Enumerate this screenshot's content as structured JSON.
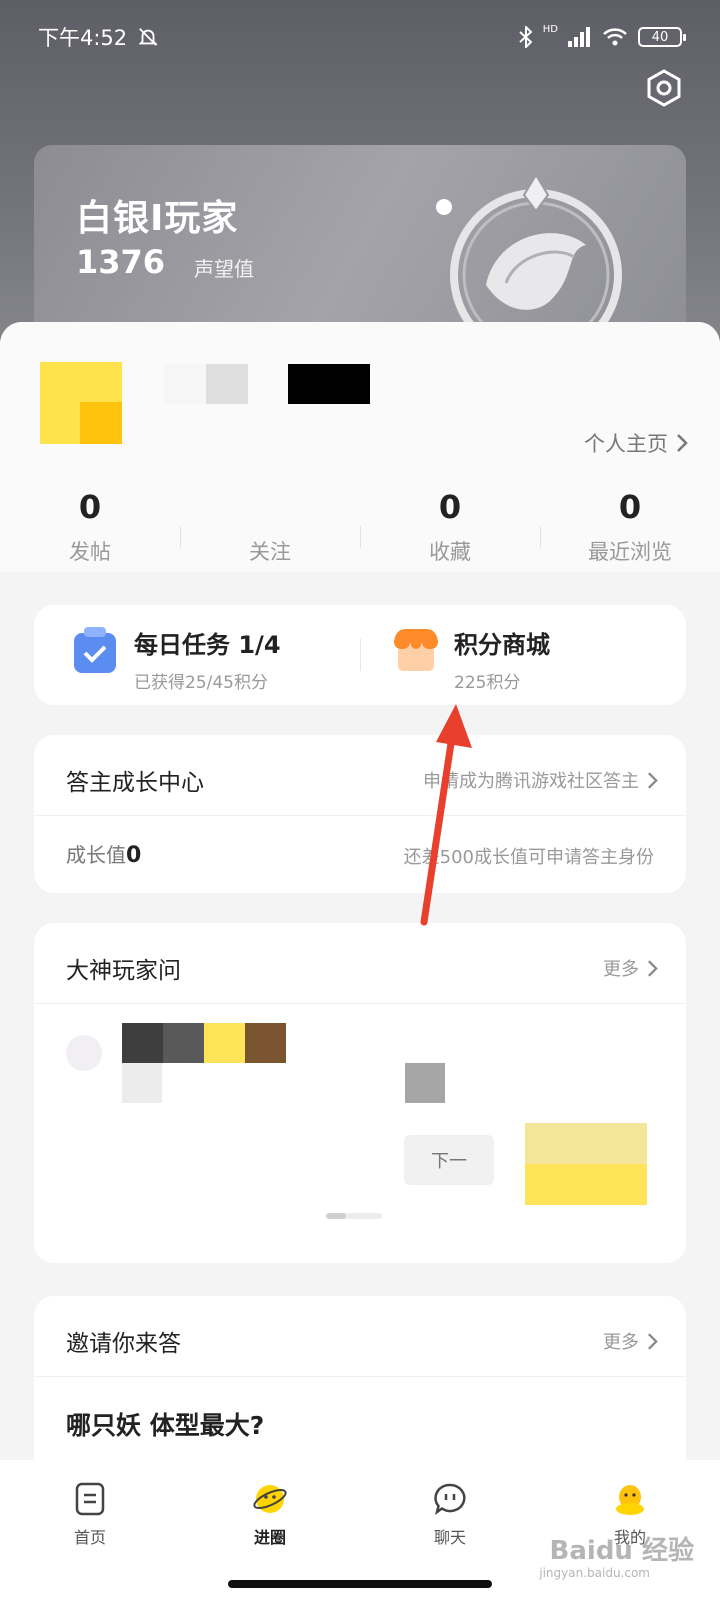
{
  "status_bar": {
    "time": "下午4:52",
    "network": "HD",
    "battery": "40"
  },
  "rank": {
    "title": "白银I玩家",
    "score": "1376",
    "score_label": "声望值"
  },
  "profile": {
    "homepage_link": "个人主页"
  },
  "stats": [
    {
      "num": "0",
      "label": "发帖"
    },
    {
      "num": "",
      "label": "关注"
    },
    {
      "num": "0",
      "label": "收藏"
    },
    {
      "num": "0",
      "label": "最近浏览"
    }
  ],
  "daily_task": {
    "title": "每日任务 1/4",
    "sub": "已获得25/45积分"
  },
  "points_mall": {
    "title": "积分商城",
    "sub": "225积分"
  },
  "growth": {
    "title": "答主成长中心",
    "apply_link": "申请成为腾讯游戏社区答主",
    "value_label": "成长值",
    "value": "0",
    "hint": "还差500成长值可申请答主身份"
  },
  "gods": {
    "title": "大神玩家问",
    "more": "更多",
    "next_label": "下一"
  },
  "invite": {
    "title": "邀请你来答",
    "more": "更多",
    "question": "哪只妖 体型最大?"
  },
  "tabs": [
    {
      "label": "首页",
      "icon": "home-icon"
    },
    {
      "label": "进圈",
      "icon": "circle-planet-icon"
    },
    {
      "label": "聊天",
      "icon": "chat-icon"
    },
    {
      "label": "我的",
      "icon": "profile-icon"
    }
  ],
  "watermark": {
    "brand": "Baidu 经验",
    "url": "jingyan.baidu.com"
  },
  "colors": {
    "accent": "#ffd400",
    "arrow": "#e8402c"
  }
}
